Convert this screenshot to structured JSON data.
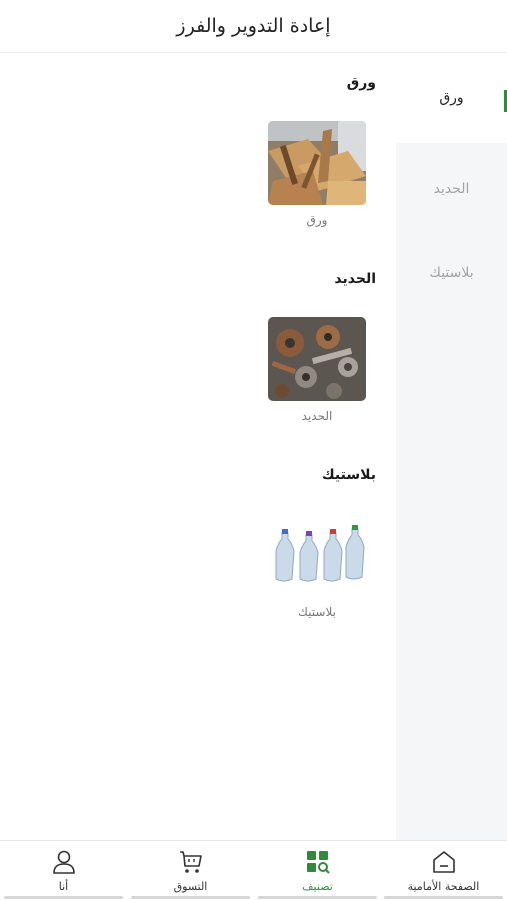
{
  "header": {
    "title": "إعادة التدوير والفرز"
  },
  "side_menu": {
    "items": [
      {
        "label": "ورق",
        "active": true
      },
      {
        "label": "الحديد",
        "active": false
      },
      {
        "label": "بلاستيك",
        "active": false
      }
    ]
  },
  "sections": [
    {
      "title": "ورق",
      "item_label": "ورق",
      "image": "cardboard-scrap-photo"
    },
    {
      "title": "الحديد",
      "item_label": "الحديد",
      "image": "scrap-metal-photo"
    },
    {
      "title": "بلاستيك",
      "item_label": "بلاستيك",
      "image": "plastic-bottles-photo"
    }
  ],
  "tab_bar": {
    "tabs": [
      {
        "label": "الصفحة الأمامية",
        "icon": "home-icon",
        "active": false
      },
      {
        "label": "تصنيف",
        "icon": "category-icon",
        "active": true
      },
      {
        "label": "التسوق",
        "icon": "cart-icon",
        "active": false
      },
      {
        "label": "أنا",
        "icon": "user-icon",
        "active": false
      }
    ]
  },
  "colors": {
    "accent": "#2e8b3a",
    "side_bg": "#f5f6f7",
    "inactive_text": "#a3a3a3"
  }
}
